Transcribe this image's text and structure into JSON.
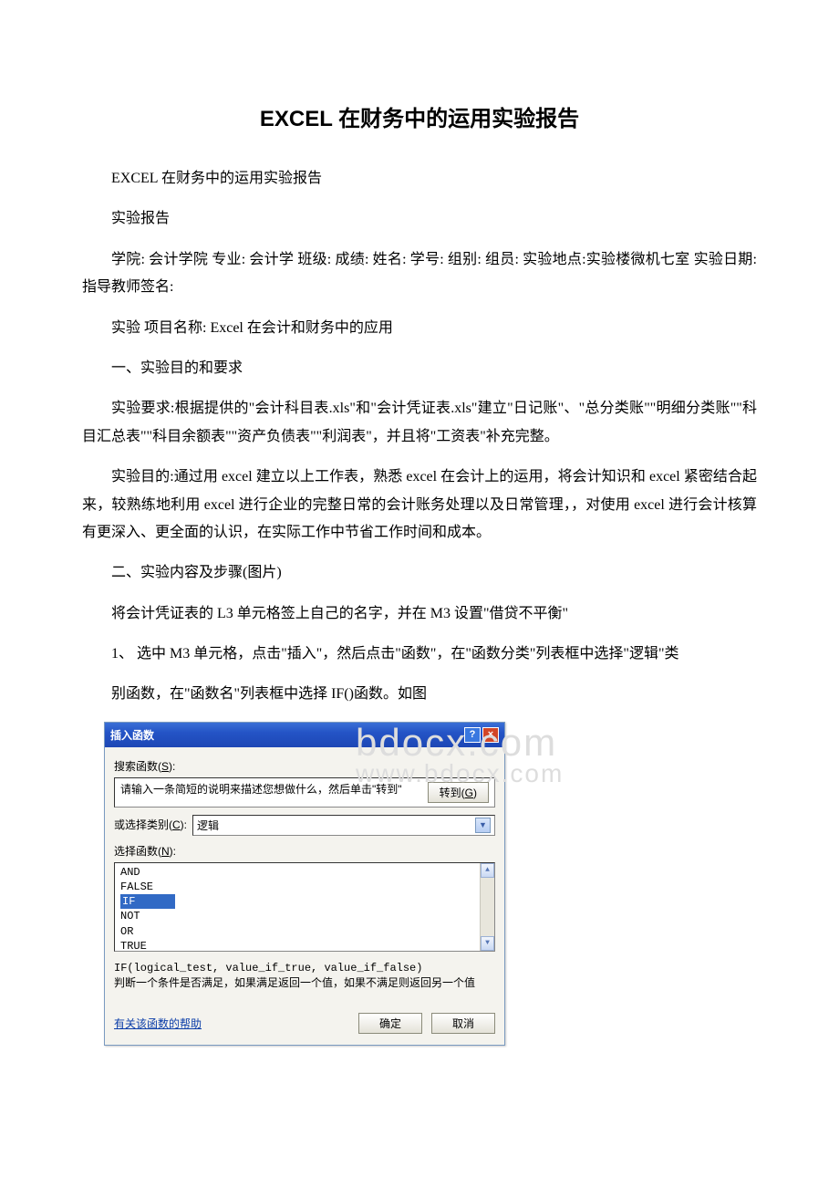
{
  "doc": {
    "title": "EXCEL 在财务中的运用实验报告",
    "p1": "EXCEL 在财务中的运用实验报告",
    "p2": "实验报告",
    "p3": "学院: 会计学院 专业: 会计学 班级: 成绩: 姓名: 学号: 组别: 组员: 实验地点:实验楼微机七室 实验日期: 指导教师签名:",
    "p4": "实验 项目名称: Excel 在会计和财务中的应用",
    "p5": "一、实验目的和要求",
    "p6": "实验要求:根据提供的\"会计科目表.xls\"和\"会计凭证表.xls\"建立\"日记账\"、\"总分类账\"\"明细分类账\"\"科目汇总表\"\"科目余额表\"\"资产负债表\"\"利润表\"，并且将\"工资表\"补充完整。",
    "p7": "实验目的:通过用 excel 建立以上工作表，熟悉 excel 在会计上的运用，将会计知识和 excel 紧密结合起来，较熟练地利用 excel 进行企业的完整日常的会计账务处理以及日常管理，，对使用 excel 进行会计核算有更深入、更全面的认识，在实际工作中节省工作时间和成本。",
    "p8": "二、实验内容及步骤(图片)",
    "p9": "将会计凭证表的 L3 单元格签上自己的名字，并在 M3 设置\"借贷不平衡\"",
    "p10": "1、 选中 M3 单元格，点击\"插入\"，然后点击\"函数\"，在\"函数分类\"列表框中选择\"逻辑\"类",
    "p11": "别函数，在\"函数名\"列表框中选择 IF()函数。如图"
  },
  "watermark_top": "bdocx.com",
  "watermark_bot": "www.bdocx.com",
  "dialog": {
    "title": "插入函数",
    "help": "?",
    "close": "×",
    "search_label_pre": "搜索函数(",
    "search_label_u": "S",
    "search_label_post": "):",
    "search_text": "请输入一条简短的说明来描述您想做什么，然后单击\"转到\"",
    "go_pre": "转到(",
    "go_u": "G",
    "go_post": ")",
    "cat_label_pre": "或选择类别(",
    "cat_label_u": "C",
    "cat_label_post": "):",
    "cat_value": "逻辑",
    "list_label_pre": "选择函数(",
    "list_label_u": "N",
    "list_label_post": "):",
    "items": {
      "i0": "AND",
      "i1": "FALSE",
      "i2": "IF",
      "i3": "NOT",
      "i4": "OR",
      "i5": "TRUE"
    },
    "sig": "IF(logical_test, value_if_true, value_if_false)",
    "explain": "判断一个条件是否满足，如果满足返回一个值，如果不满足则返回另一个值",
    "helplink": "有关该函数的帮助",
    "ok": "确定",
    "cancel": "取消",
    "up": "▲",
    "down": "▼",
    "drop": "▼"
  }
}
